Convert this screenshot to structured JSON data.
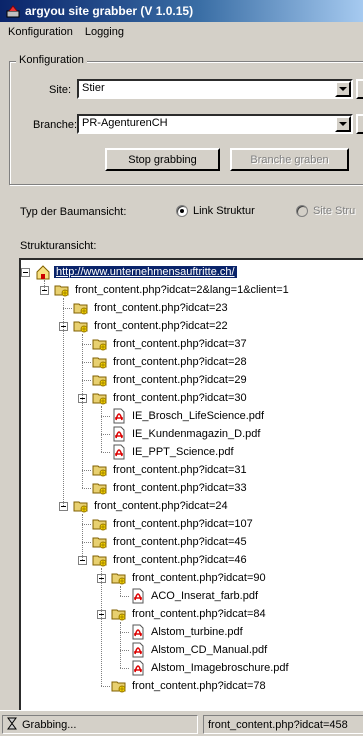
{
  "window": {
    "title": "argyou site grabber (V 1.0.15)"
  },
  "menu": [
    "Konfiguration",
    "Logging"
  ],
  "config": {
    "legend": "Konfiguration",
    "site_label": "Site:",
    "site_value": "Stier",
    "branche_label": "Branche:",
    "branche_value": "PR-AgenturenCH",
    "stop_button": "Stop grabbing",
    "branche_button": "Branche graben"
  },
  "treeview_type": {
    "label": "Typ der Baumansicht:",
    "option_link": "Link Struktur",
    "option_site": "Site Stru"
  },
  "structure": {
    "label": "Strukturansicht:",
    "rows": [
      {
        "text": "http://www.unternehmensauftritte.ch/",
        "type": "root",
        "level": 0,
        "selected": true
      },
      {
        "text": "front_content.php?idcat=2&lang=1&client=1",
        "type": "folder",
        "level": 1
      },
      {
        "text": "front_content.php?idcat=23",
        "type": "folder",
        "level": 2
      },
      {
        "text": "front_content.php?idcat=22",
        "type": "folder",
        "level": 2
      },
      {
        "text": "front_content.php?idcat=37",
        "type": "folder",
        "level": 3
      },
      {
        "text": "front_content.php?idcat=28",
        "type": "folder",
        "level": 3
      },
      {
        "text": "front_content.php?idcat=29",
        "type": "folder",
        "level": 3
      },
      {
        "text": "front_content.php?idcat=30",
        "type": "folder",
        "level": 3
      },
      {
        "text": "IE_Brosch_LifeScience.pdf",
        "type": "pdf",
        "level": 4
      },
      {
        "text": "IE_Kundenmagazin_D.pdf",
        "type": "pdf",
        "level": 4
      },
      {
        "text": "IE_PPT_Science.pdf",
        "type": "pdf",
        "level": 4
      },
      {
        "text": "front_content.php?idcat=31",
        "type": "folder",
        "level": 3
      },
      {
        "text": "front_content.php?idcat=33",
        "type": "folder",
        "level": 3
      },
      {
        "text": "front_content.php?idcat=24",
        "type": "folder",
        "level": 2
      },
      {
        "text": "front_content.php?idcat=107",
        "type": "folder",
        "level": 3
      },
      {
        "text": "front_content.php?idcat=45",
        "type": "folder",
        "level": 3
      },
      {
        "text": "front_content.php?idcat=46",
        "type": "folder",
        "level": 3
      },
      {
        "text": "front_content.php?idcat=90",
        "type": "folder",
        "level": 4
      },
      {
        "text": "ACO_Inserat_farb.pdf",
        "type": "pdf",
        "level": 5
      },
      {
        "text": "front_content.php?idcat=84",
        "type": "folder",
        "level": 4
      },
      {
        "text": "Alstom_turbine.pdf",
        "type": "pdf",
        "level": 5
      },
      {
        "text": "Alstom_CD_Manual.pdf",
        "type": "pdf",
        "level": 5
      },
      {
        "text": "Alstom_Imagebroschure.pdf",
        "type": "pdf",
        "level": 5
      },
      {
        "text": "front_content.php?idcat=78",
        "type": "folder",
        "level": 4
      }
    ]
  },
  "status": {
    "left": "Grabbing...",
    "right": "front_content.php?idcat=458"
  }
}
